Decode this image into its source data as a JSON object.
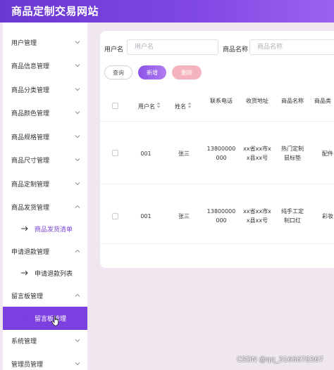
{
  "app_title": "商品定制交易网站",
  "sidebar": {
    "items": [
      {
        "label": "用户管理"
      },
      {
        "label": "商品信息管理"
      },
      {
        "label": "商品分类管理"
      },
      {
        "label": "商品颜色管理"
      },
      {
        "label": "商品规格管理"
      },
      {
        "label": "商品尺寸管理"
      },
      {
        "label": "商品定制管理"
      },
      {
        "label": "商品发货管理"
      },
      {
        "label": "商品发货清单"
      },
      {
        "label": "申请退款管理"
      },
      {
        "label": "申请退款列表"
      },
      {
        "label": "留言板管理"
      },
      {
        "label": "留言板管理"
      },
      {
        "label": "系统管理"
      },
      {
        "label": "管理员管理"
      }
    ]
  },
  "filters": {
    "username_label": "用户名",
    "username_placeholder": "用户名",
    "product_label": "商品名称",
    "product_placeholder": "商品名称"
  },
  "buttons": {
    "query": "查询",
    "add": "新增",
    "delete": "删除"
  },
  "table": {
    "headers": [
      "用户名",
      "姓名",
      "联系电话",
      "收货地址",
      "商品名称",
      "商品类"
    ],
    "rows": [
      [
        "001",
        "张三",
        "13800000000",
        "xx省xx市xx县xx号",
        "热门定制鼠标垫",
        "配件"
      ],
      [
        "001",
        "张三",
        "13800000000",
        "xx省xx市xx县xx号",
        "纯手工定制口红",
        "彩妆"
      ]
    ]
  },
  "watermark": "CSDN @qq_3166678367",
  "colors": {
    "header_gradient_start": "#6a38d0",
    "header_gradient_end": "#9a62ef",
    "active_menu": "#7c3fe0",
    "submenu_text": "#7b46d8",
    "add_button": "#8a52e6",
    "delete_button": "#f4b3bf",
    "page_background": "#efe6f0"
  },
  "icons": {
    "menu_expand": "chevron-down-icon",
    "menu_collapse": "chevron-up-icon",
    "submenu_marker": "arrow-right-icon",
    "sort": "sort-icon",
    "pointer": "hand-cursor-icon"
  }
}
